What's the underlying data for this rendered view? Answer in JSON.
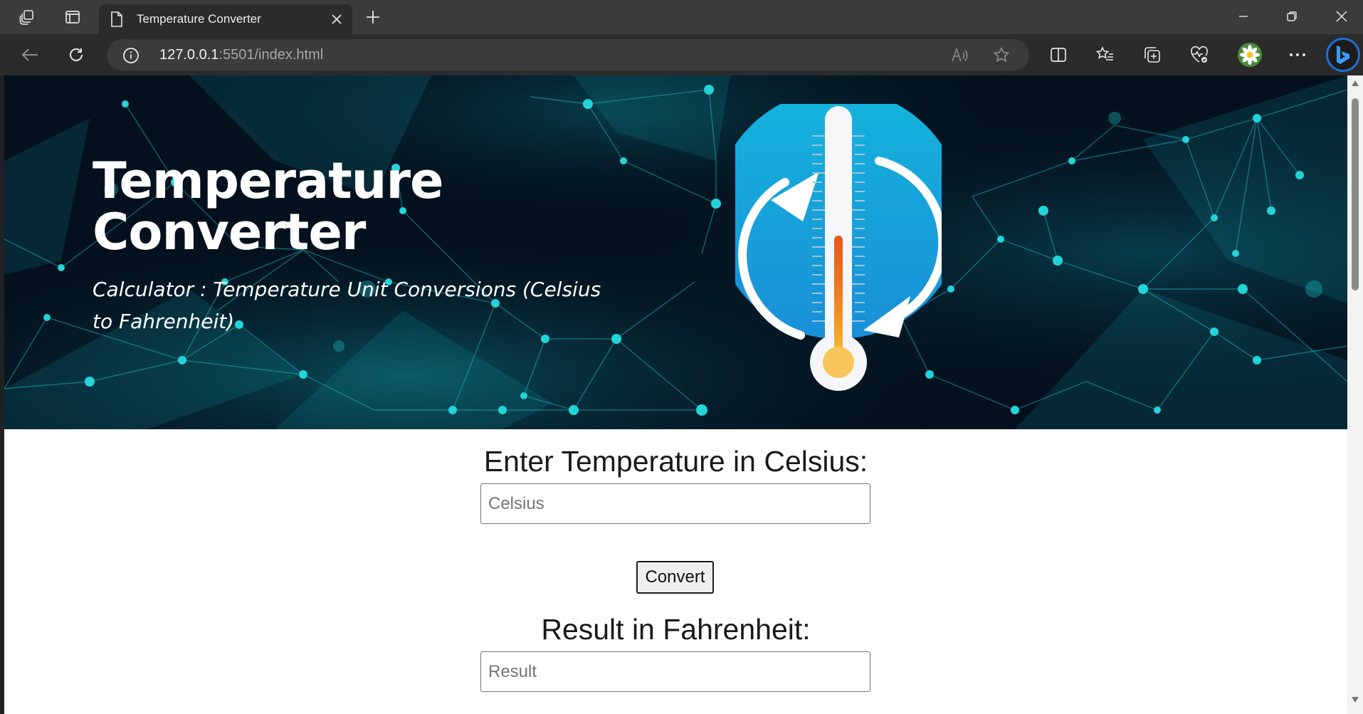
{
  "browser": {
    "tab": {
      "title": "Temperature Converter"
    },
    "url": {
      "host": "127.0.0.1",
      "rest": ":5501/index.html"
    },
    "icons": {
      "workspaces": "workspaces-icon",
      "tab_actions": "vertical-tabs-icon",
      "new_tab": "plus-icon",
      "back": "back-arrow-icon",
      "refresh": "refresh-icon",
      "site_info": "info-icon",
      "read_aloud": "read-aloud-icon",
      "favorite": "star-icon",
      "split_screen": "split-screen-icon",
      "favorites": "favorites-list-icon",
      "collections": "collections-icon",
      "performance": "heart-pulse-icon",
      "more": "more-dots-icon",
      "copilot": "bing-icon"
    }
  },
  "hero": {
    "title": "Temperature Converter",
    "subtitle": "Calculator : Temperature Unit Conversions (Celsius to Fahrenheit)"
  },
  "form": {
    "celsius_label": "Enter Temperature in Celsius:",
    "celsius_placeholder": "Celsius",
    "celsius_value": "",
    "convert_label": "Convert",
    "result_label": "Result in Fahrenheit:",
    "result_placeholder": "Result",
    "result_value": ""
  },
  "colors": {
    "tabstrip": "#3b3b3b",
    "toolbar": "#2b2b2b",
    "hero_bg": "#04101d",
    "network_accent": "#1fd3d6",
    "thermo_disc": "#1fa3dd",
    "mercury": "#f07a1e"
  }
}
